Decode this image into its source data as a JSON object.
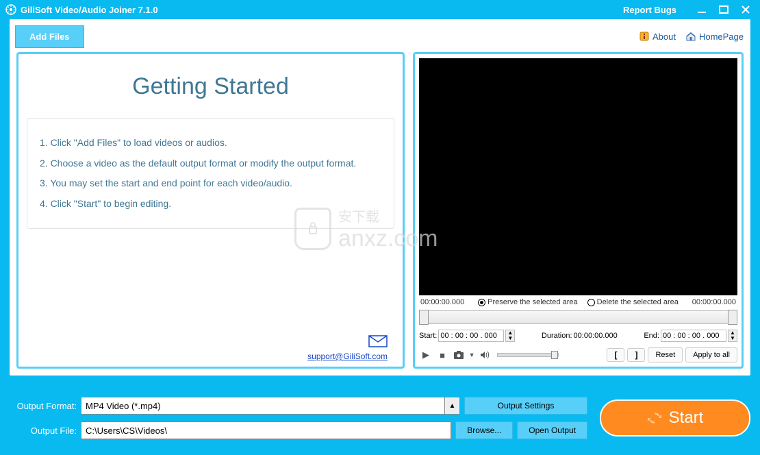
{
  "titlebar": {
    "title": "GiliSoft Video/Audio Joiner 7.1.0",
    "report_bugs": "Report Bugs"
  },
  "toolbar": {
    "add_files": "Add Files",
    "about": "About",
    "homepage": "HomePage"
  },
  "getting_started": {
    "title": "Getting Started",
    "step1": "1. Click \"Add Files\" to load videos or audios.",
    "step2": "2. Choose a video as the default output format or modify the output format.",
    "step3": "3. You may set the start and end point for each video/audio.",
    "step4": "4. Click \"Start\" to begin editing.",
    "support_link": "support@GiliSoft.com"
  },
  "preview": {
    "time_left": "00:00:00.000",
    "time_right": "00:00:00.000",
    "preserve_label": "Preserve the selected area",
    "delete_label": "Delete the selected area",
    "selected_mode": "preserve",
    "start_label": "Start:",
    "start_value": "00 : 00 : 00 . 000",
    "duration_label": "Duration:",
    "duration_value": "00:00:00.000",
    "end_label": "End:",
    "end_value": "00 : 00 : 00 . 000",
    "reset": "Reset",
    "apply_all": "Apply to all"
  },
  "output": {
    "format_label": "Output Format:",
    "format_value": "MP4 Video (*.mp4)",
    "file_label": "Output File:",
    "file_value": "C:\\Users\\CS\\Videos\\",
    "output_settings": "Output Settings",
    "browse": "Browse...",
    "open_output": "Open Output",
    "start": "Start"
  },
  "watermark": {
    "text": "anxz.com",
    "sub": "安下载"
  }
}
